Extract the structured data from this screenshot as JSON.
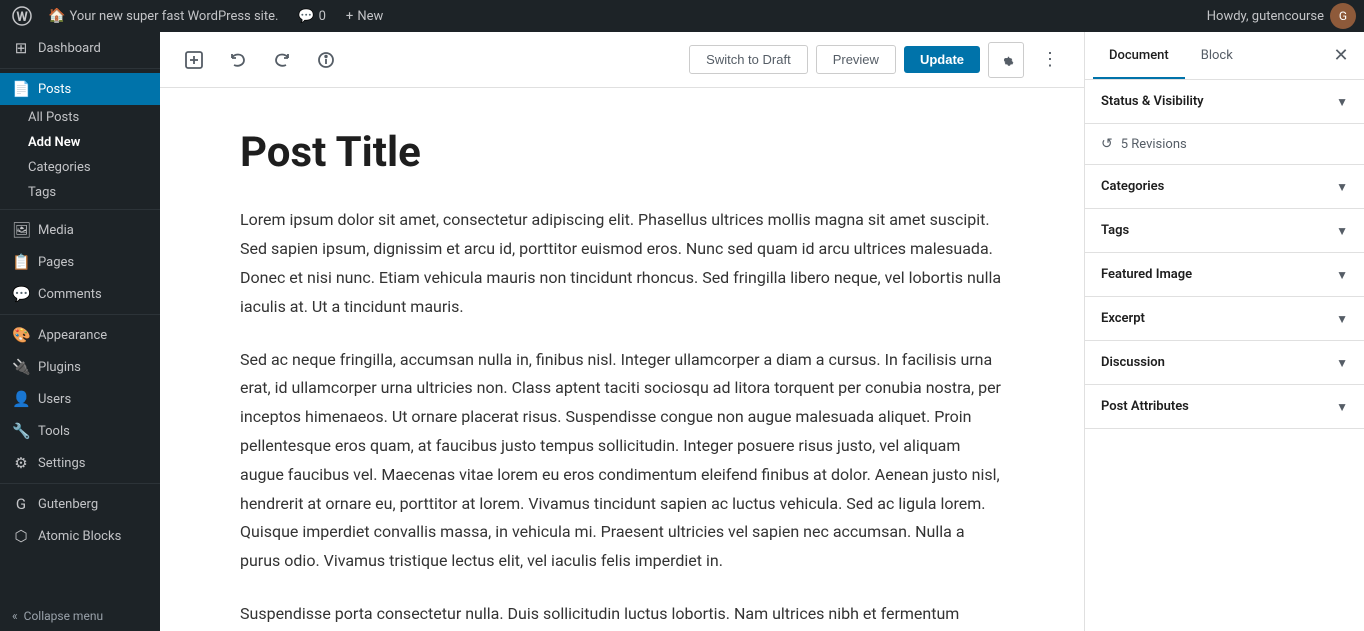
{
  "admin_bar": {
    "logo": "W",
    "site_name": "Your new super fast WordPress site.",
    "comments_count": "0",
    "new_label": "New",
    "howdy": "Howdy, gutencourse",
    "avatar_initials": "G"
  },
  "sidebar": {
    "dashboard_label": "Dashboard",
    "posts_label": "Posts",
    "all_posts_label": "All Posts",
    "add_new_label": "Add New",
    "categories_label": "Categories",
    "tags_label": "Tags",
    "media_label": "Media",
    "pages_label": "Pages",
    "comments_label": "Comments",
    "appearance_label": "Appearance",
    "plugins_label": "Plugins",
    "users_label": "Users",
    "tools_label": "Tools",
    "settings_label": "Settings",
    "gutenberg_label": "Gutenberg",
    "atomic_blocks_label": "Atomic Blocks",
    "collapse_label": "Collapse menu"
  },
  "toolbar": {
    "switch_draft_label": "Switch to Draft",
    "preview_label": "Preview",
    "update_label": "Update"
  },
  "editor": {
    "post_title": "Post Title",
    "paragraph_1": "Lorem ipsum dolor sit amet, consectetur adipiscing elit. Phasellus ultrices mollis magna sit amet suscipit. Sed sapien ipsum, dignissim et arcu id, porttitor euismod eros. Nunc sed quam id arcu ultrices malesuada. Donec et nisi nunc. Etiam vehicula mauris non tincidunt rhoncus. Sed fringilla libero neque, vel lobortis nulla iaculis at. Ut a tincidunt mauris.",
    "paragraph_2": "Sed ac neque fringilla, accumsan nulla in, finibus nisl. Integer ullamcorper a diam a cursus. In facilisis urna erat, id ullamcorper urna ultricies non. Class aptent taciti sociosqu ad litora torquent per conubia nostra, per inceptos himenaeos. Ut ornare placerat risus. Suspendisse congue non augue malesuada aliquet. Proin pellentesque eros quam, at faucibus justo tempus sollicitudin. Integer posuere risus justo, vel aliquam augue faucibus vel. Maecenas vitae lorem eu eros condimentum eleifend finibus at dolor. Aenean justo nisl, hendrerit at ornare eu, porttitor at lorem. Vivamus tincidunt sapien ac luctus vehicula. Sed ac ligula lorem. Quisque imperdiet convallis massa, in vehicula mi. Praesent ultricies vel sapien nec accumsan. Nulla a purus odio. Vivamus tristique lectus elit, vel iaculis felis imperdiet in.",
    "paragraph_3": "Suspendisse porta consectetur nulla. Duis sollicitudin luctus lobortis. Nam ultrices nibh et fermentum"
  },
  "right_panel": {
    "document_tab": "Document",
    "block_tab": "Block",
    "close_icon": "✕",
    "status_visibility_label": "Status & Visibility",
    "revisions_label": "5 Revisions",
    "categories_label": "Categories",
    "tags_label": "Tags",
    "featured_image_label": "Featured Image",
    "excerpt_label": "Excerpt",
    "discussion_label": "Discussion",
    "post_attributes_label": "Post Attributes"
  }
}
